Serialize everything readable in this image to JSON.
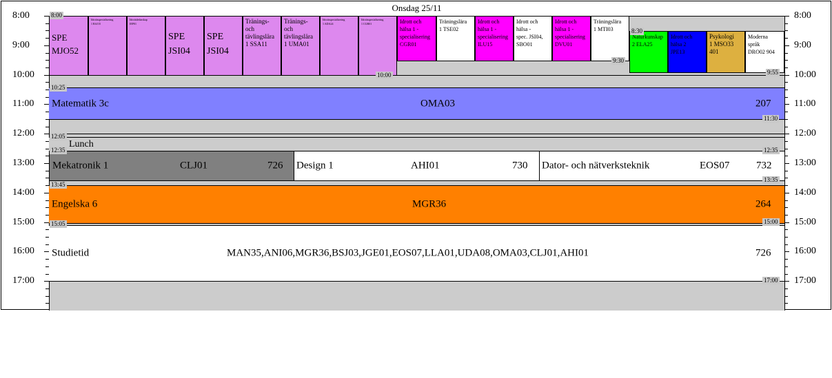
{
  "day_header": "Onsdag 25/11",
  "hours": [
    "8:00",
    "9:00",
    "10:00",
    "11:00",
    "12:00",
    "13:00",
    "14:00",
    "15:00",
    "16:00",
    "17:00"
  ],
  "time_labels": {
    "t0800": "8:00",
    "t0830": "8:30",
    "t0930": "9:30",
    "t0955": "9:55",
    "t1000": "10:00",
    "t1025": "10:25",
    "t1130": "11:30",
    "t1205": "12:05",
    "t1235a": "12:35",
    "t1235b": "12:35",
    "t1335": "13:35",
    "t1345": "13:45",
    "t1500": "15:00",
    "t1505": "15:05",
    "t1700": "17:00"
  },
  "morning": [
    {
      "lines": [
        "SPE",
        "MJO52"
      ],
      "color": "#dd88ee"
    },
    {
      "lines": [
        "Idrottsspecialisering",
        "1 RAJ15"
      ],
      "color": "#dd88ee"
    },
    {
      "lines": [
        "Idrottsledarskap",
        "IEP01"
      ],
      "color": "#dd88ee"
    },
    {
      "lines": [
        "SPE",
        "JSI04"
      ],
      "color": "#dd88ee"
    },
    {
      "lines": [
        "SPE",
        "JSI04"
      ],
      "color": "#dd88ee"
    },
    {
      "lines": [
        "Tränings-",
        "och",
        "tävlingslära",
        "1 SSA11"
      ],
      "color": "#dd88ee"
    },
    {
      "lines": [
        "Tränings-",
        "och",
        "tävlingslära",
        "1 UMA01"
      ],
      "color": "#dd88ee"
    },
    {
      "lines": [
        "Idrottsspecialisering",
        "1 ADA24"
      ],
      "color": "#dd88ee"
    },
    {
      "lines": [
        "Idrottsspecialisering",
        "1 CGR01"
      ],
      "color": "#dd88ee"
    },
    {
      "lines": [
        "Idrott och",
        "hälsa 1 -",
        "specialisering",
        "CGR01"
      ],
      "color": "#ff00ff"
    },
    {
      "lines": [
        "Träningslära",
        "1 TSE02"
      ],
      "color": "#ffffff"
    },
    {
      "lines": [
        "Idrott och",
        "hälsa 1 -",
        "specialisering",
        "ILU15"
      ],
      "color": "#ff00ff"
    },
    {
      "lines": [
        "Idrott och",
        "hälsa -",
        "spec. JSI04,",
        "SBO01"
      ],
      "color": "#ffffff"
    },
    {
      "lines": [
        "Idrott och",
        "hälsa 1 -",
        "specialisering",
        "DVU01"
      ],
      "color": "#ff00ff"
    },
    {
      "lines": [
        "Träningslära",
        "1 MTI03"
      ],
      "color": "#ffffff"
    },
    {
      "lines": [
        "Naturkunskap",
        "2 ELA25"
      ],
      "color": "#00ff00"
    },
    {
      "lines": [
        "Idrott och",
        "hälsa 2",
        "JPE13"
      ],
      "color": "#0000ff"
    },
    {
      "lines": [
        "Psykologi",
        "1 MSO33",
        "401"
      ],
      "color": "#ddb040"
    },
    {
      "lines": [
        "Moderna",
        "språk",
        "DRO02 904"
      ],
      "color": "#ffffff"
    }
  ],
  "math": {
    "name": "Matematik 3c",
    "code": "OMA03",
    "room": "207",
    "color": "#8080ff"
  },
  "lunch": "Lunch",
  "meka": {
    "name": "Mekatronik 1",
    "code": "CLJ01",
    "room": "726",
    "color": "#808080"
  },
  "design": {
    "name": "Design 1",
    "code": "AHI01",
    "room": "730",
    "color": "#ffffff"
  },
  "dator": {
    "name": "Dator- och nätverksteknik",
    "code": "EOS07",
    "room": "732",
    "color": "#ffffff"
  },
  "eng": {
    "name": "Engelska 6",
    "code": "MGR36",
    "room": "264",
    "color": "#ff8000"
  },
  "studie": {
    "name": "Studietid",
    "codes": "MAN35,ANI06,MGR36,BSJ03,JGE01,EOS07,LLA01,UDA08,OMA03,CLJ01,AHI01",
    "room": "726",
    "color": "#ffffff"
  }
}
